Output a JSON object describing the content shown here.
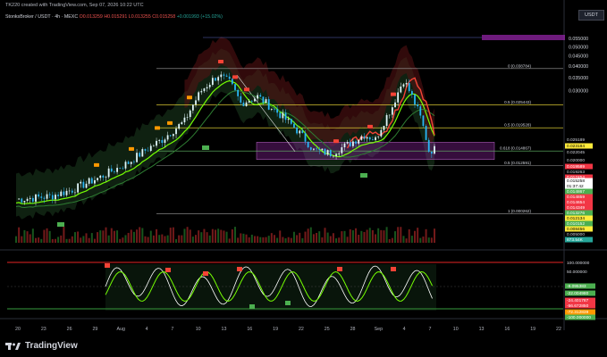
{
  "header": {
    "created_by": "TK220 created with TradingView.com, Sep 07, 2026 10:22 UTC"
  },
  "symbol": {
    "name": "StonksBroker / USDT · 4h · MEXC",
    "open": "O0.013259",
    "high": "H0.015291",
    "low": "L0.013255",
    "close": "C0.015258",
    "change": "+0.001993 (+15.02%)"
  },
  "currency": "USDT",
  "price_axis": {
    "ticks": [
      "0.055000",
      "0.050000",
      "0.045000",
      "0.040000",
      "0.035000",
      "0.030000"
    ],
    "labels": [
      {
        "text": "0.025189",
        "bg": "#000000",
        "fg": "#d1d4dc"
      },
      {
        "text": "0.023184",
        "bg": "#ffeb3b",
        "fg": "#000000"
      },
      {
        "text": "0.022045",
        "bg": "#000000",
        "fg": "#d1d4dc"
      },
      {
        "text": "0.020000",
        "bg": "#000000",
        "fg": "#d1d4dc"
      },
      {
        "text": "0.019589",
        "bg": "#f23645",
        "fg": "#ffffff"
      },
      {
        "text": "0.019263",
        "bg": "#000000",
        "fg": "#d1d4dc"
      },
      {
        "text": "0.017454",
        "bg": "#f23645",
        "fg": "#ffffff"
      },
      {
        "text": "0.015258",
        "bg": "#ffffff",
        "fg": "#000000"
      },
      {
        "text": "01:37:42",
        "bg": "#ffffff",
        "fg": "#000000"
      },
      {
        "text": "0.014867",
        "bg": "#4caf50",
        "fg": "#ffffff"
      },
      {
        "text": "0.014859",
        "bg": "#f23645",
        "fg": "#ffffff"
      },
      {
        "text": "0.014654",
        "bg": "#f23645",
        "fg": "#ffffff"
      },
      {
        "text": "0.014349",
        "bg": "#f23645",
        "fg": "#ffffff"
      },
      {
        "text": "0.013276",
        "bg": "#4caf50",
        "fg": "#ffffff"
      },
      {
        "text": "0.012134",
        "bg": "#ffeb3b",
        "fg": "#000000"
      },
      {
        "text": "0.010152",
        "bg": "#4caf50",
        "fg": "#ffffff"
      },
      {
        "text": "0.008456",
        "bg": "#ffeb3b",
        "fg": "#000000"
      },
      {
        "text": "0.005000",
        "bg": "#000000",
        "fg": "#d1d4dc"
      },
      {
        "text": "873.54K",
        "bg": "#26a69a",
        "fg": "#ffffff"
      }
    ]
  },
  "fib_levels": [
    {
      "label": "0 (0.038784)"
    },
    {
      "label": "0.5 (0.025443)"
    },
    {
      "label": "0.5 (0.019528)"
    },
    {
      "label": "0.618 (0.014867)"
    },
    {
      "label": "0.5 (0.012591)"
    },
    {
      "label": "1 (0.000262)"
    }
  ],
  "oscillator_axis": {
    "labels": [
      {
        "text": "100.000000",
        "bg": "#000000",
        "fg": "#d1d4dc"
      },
      {
        "text": "50.000000",
        "bg": "#000000",
        "fg": "#d1d4dc"
      },
      {
        "text": "-8.095383",
        "bg": "#4caf50",
        "fg": "#ffffff"
      },
      {
        "text": "-22.004980",
        "bg": "#4caf50",
        "fg": "#ffffff"
      },
      {
        "text": "-24.401787",
        "bg": "#f23645",
        "fg": "#ffffff"
      },
      {
        "text": "-56.672850",
        "bg": "#f23645",
        "fg": "#ffffff"
      },
      {
        "text": "-72.312839",
        "bg": "#ff9800",
        "fg": "#ffffff"
      },
      {
        "text": "-100.000000",
        "bg": "#4caf50",
        "fg": "#ffffff"
      }
    ]
  },
  "time_axis": {
    "labels": [
      "20",
      "23",
      "26",
      "29",
      "Aug",
      "4",
      "7",
      "10",
      "13",
      "16",
      "19",
      "22",
      "25",
      "28",
      "Sep",
      "4",
      "7",
      "10",
      "13",
      "16",
      "19",
      "22"
    ]
  },
  "footer": {
    "brand": "TradingView"
  },
  "colors": {
    "up": "#26a69a",
    "down": "#ef5350",
    "band_green": "#4caf50",
    "band_red": "#b71c1c",
    "fib": "#ffeb3b",
    "zone": "#9c27b0"
  }
}
